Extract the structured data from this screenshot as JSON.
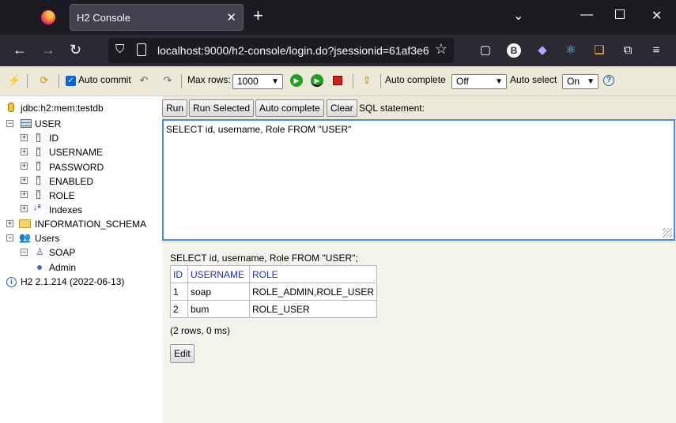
{
  "browser": {
    "tab_title": "H2 Console",
    "url": "localhost:9000/h2-console/login.do?jsessionid=61af3e6"
  },
  "toolbar": {
    "auto_commit_label": "Auto commit",
    "max_rows_label": "Max rows:",
    "max_rows_value": "1000",
    "auto_complete_label": "Auto complete",
    "auto_complete_value": "Off",
    "auto_select_label": "Auto select",
    "auto_select_value": "On",
    "help_label": "?"
  },
  "tree": {
    "db": "jdbc:h2:mem:testdb",
    "table": "USER",
    "columns": [
      "ID",
      "USERNAME",
      "PASSWORD",
      "ENABLED",
      "ROLE"
    ],
    "indexes": "Indexes",
    "schema": "INFORMATION_SCHEMA",
    "users": "Users",
    "user_soap": "SOAP",
    "user_role": "Admin",
    "version": "H2 2.1.214 (2022-06-13)"
  },
  "editor": {
    "run": "Run",
    "run_selected": "Run Selected",
    "auto_complete": "Auto complete",
    "clear": "Clear",
    "sql_label": "SQL statement:",
    "sql": "SELECT id, username, Role FROM \"USER\""
  },
  "result": {
    "statement": "SELECT id, username, Role FROM \"USER\";",
    "headers": [
      "ID",
      "USERNAME",
      "ROLE"
    ],
    "rows": [
      [
        "1",
        "soap",
        "ROLE_ADMIN,ROLE_USER"
      ],
      [
        "2",
        "bum",
        "ROLE_USER"
      ]
    ],
    "info": "(2 rows, 0 ms)",
    "edit": "Edit"
  }
}
